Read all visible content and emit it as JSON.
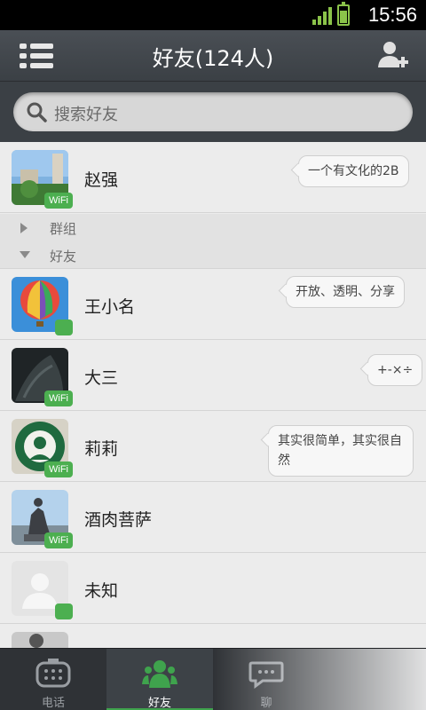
{
  "status_bar": {
    "time": "15:56",
    "battery_color": "#8bc34a"
  },
  "header": {
    "title": "好友(124人)",
    "menu_icon": "list-menu-icon",
    "add_icon": "add-friend-icon"
  },
  "search": {
    "placeholder": "搜索好友"
  },
  "top_contact": {
    "name": "赵强",
    "status": "一个有文化的2B",
    "badge": "WiFi"
  },
  "groups": [
    {
      "label": "群组",
      "expanded": false
    },
    {
      "label": "好友",
      "expanded": true
    }
  ],
  "contacts": [
    {
      "name": "王小名",
      "status": "开放、透明、分享",
      "badge": ""
    },
    {
      "name": "大三",
      "status": "+-×÷",
      "badge": "WiFi"
    },
    {
      "name": "莉莉",
      "status": "其实很简单，其实很自然",
      "badge": "WiFi"
    },
    {
      "name": "酒肉菩萨",
      "status": "",
      "badge": "WiFi"
    },
    {
      "name": "未知",
      "status": "",
      "badge": ""
    }
  ],
  "tabs": [
    {
      "label": "电话",
      "active": false
    },
    {
      "label": "好友",
      "active": true
    },
    {
      "label": "聊",
      "active": false
    }
  ],
  "colors": {
    "accent": "#3fa34d",
    "header_bg": "#3b4045",
    "list_bg": "#ececec"
  }
}
